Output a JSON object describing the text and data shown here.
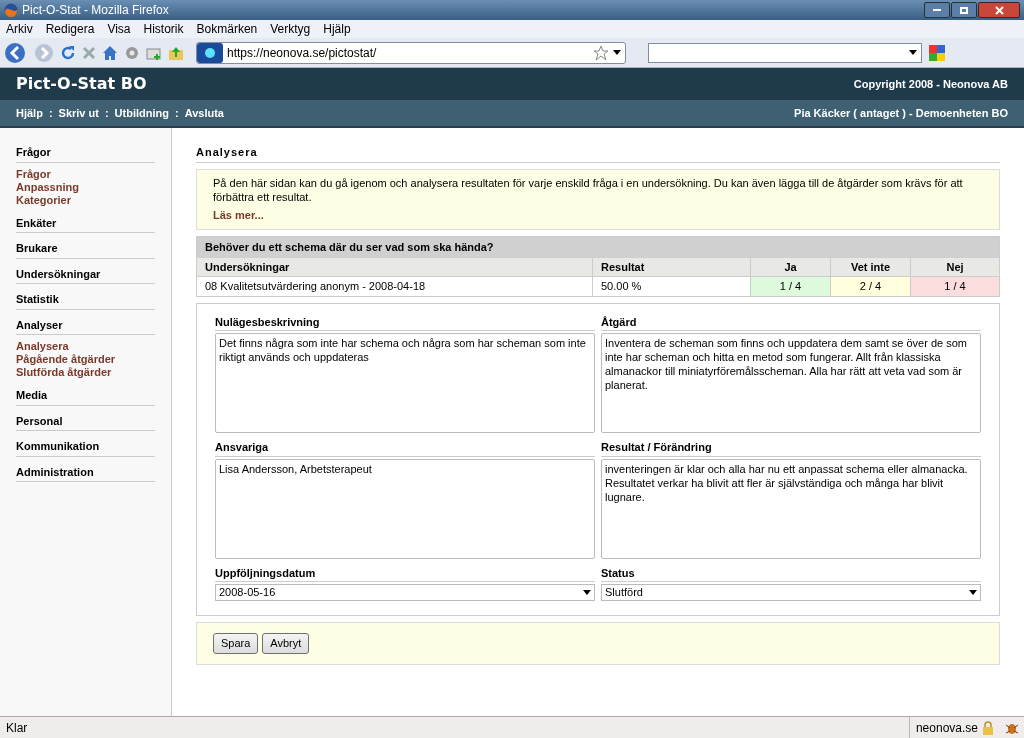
{
  "window": {
    "title": "Pict-O-Stat - Mozilla Firefox"
  },
  "menu_bar": [
    "Arkiv",
    "Redigera",
    "Visa",
    "Historik",
    "Bokmärken",
    "Verktyg",
    "Hjälp"
  ],
  "toolbar": {
    "url": "https://neonova.se/pictostat/"
  },
  "site_header": {
    "title": "Pict-O-Stat BO",
    "copyright": "Copyright 2008 - Neonova AB"
  },
  "nav": {
    "links": [
      "Hjälp",
      "Skriv ut",
      "Utbildning",
      "Avsluta"
    ],
    "separator": ":",
    "user": "Pia Käcker ( antaget ) - Demoenheten BO"
  },
  "sidebar": [
    {
      "heading": "Frågor",
      "items": [
        "Frågor",
        "Anpassning",
        "Kategorier"
      ]
    },
    {
      "heading": "Enkäter"
    },
    {
      "heading": "Brukare"
    },
    {
      "heading": "Undersökningar"
    },
    {
      "heading": "Statistik"
    },
    {
      "heading": "Analyser",
      "items": [
        "Analysera",
        "Pågående åtgärder",
        "Slutförda åtgärder"
      ]
    },
    {
      "heading": "Media"
    },
    {
      "heading": "Personal"
    },
    {
      "heading": "Kommunikation"
    },
    {
      "heading": "Administration"
    }
  ],
  "page": {
    "heading": "Analysera",
    "info": "På den här sidan kan du gå igenom och analysera resultaten för varje enskild fråga i en undersökning. Du kan även lägga till de åtgärder som krävs för att förbättra ett resultat.",
    "read_more": "Läs mer..."
  },
  "question_table": {
    "question": "Behöver du ett schema där du ser vad som ska hända?",
    "columns": [
      "Undersökningar",
      "Resultat",
      "Ja",
      "Vet inte",
      "Nej"
    ],
    "rows": [
      {
        "survey": "08 Kvalitetsutvärdering anonym - 2008-04-18",
        "result": "50.00 %",
        "answers": [
          {
            "value": "1 / 4",
            "color": "#ddfadd"
          },
          {
            "value": "2 / 4",
            "color": "#fefedd"
          },
          {
            "value": "1 / 4",
            "color": "#fbdddd"
          }
        ]
      }
    ]
  },
  "form": {
    "fields": [
      {
        "kind": "textarea",
        "label": "Nulägesbeskrivning",
        "value": "Det finns några som inte har schema och några som har scheman som inte riktigt används och uppdateras"
      },
      {
        "kind": "textarea",
        "label": "Åtgärd",
        "value": "Inventera de scheman som finns och uppdatera dem samt se över de som inte har scheman och hitta en metod som fungerar. Allt från klassiska almanackor till miniatyrföremålsscheman. Alla har rätt att veta vad som är planerat."
      },
      {
        "kind": "textarea",
        "label": "Ansvariga",
        "value": "Lisa Andersson, Arbetsterapeut"
      },
      {
        "kind": "textarea",
        "label": "Resultat / Förändring",
        "value": "inventeringen är klar och alla har nu ett anpassat schema eller almanacka. Resultatet verkar ha blivit att fler är självständiga och många har blivit lugnare."
      },
      {
        "kind": "select",
        "label": "Uppföljningsdatum",
        "value": "2008-05-16"
      },
      {
        "kind": "select",
        "label": "Status",
        "value": "Slutförd"
      }
    ]
  },
  "buttons": [
    "Spara",
    "Avbryt"
  ],
  "status_bar": {
    "text": "Klar",
    "domain": "neonova.se"
  }
}
